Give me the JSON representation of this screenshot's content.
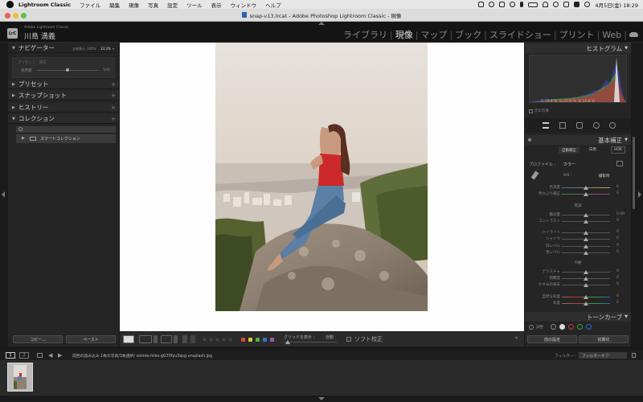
{
  "menubar": {
    "app": "Lightroom Classic",
    "items": [
      "ファイル",
      "編集",
      "現像",
      "写真",
      "設定",
      "ツール",
      "表示",
      "ウィンドウ",
      "ヘルプ"
    ],
    "datetime": "4月5日(金)  18:29"
  },
  "window": {
    "title": "snap-v13.lrcat - Adobe Photoshop Lightroom Classic - 現像"
  },
  "identity": {
    "small": "Adobe Lightroom Classic",
    "name": "川島 満義",
    "badge": "LrC"
  },
  "modules": [
    "ライブラリ",
    "現像",
    "マップ",
    "ブック",
    "スライドショー",
    "プリント",
    "Web"
  ],
  "active_module": "現像",
  "left_panel": {
    "navigator": {
      "label": "ナビゲーター",
      "zoom_options": [
        "全体表示",
        "100%",
        "33.3%"
      ]
    },
    "preset_amount": {
      "label": "プリセット : 補正",
      "sub": "適用量",
      "value": "100"
    },
    "sections": [
      "プリセット",
      "スナップショット",
      "ヒストリー",
      "コレクション"
    ],
    "collection_item": "スマートコレクション",
    "copy_label": "コピー...",
    "paste_label": "ペースト"
  },
  "right_panel": {
    "histogram_label": "ヒストグラム",
    "histogram_readout": {
      "r_label": "R",
      "r_value": "79.4",
      "g_label": "G",
      "g_value": "22.0",
      "b_label": "B",
      "b_value": "14.8",
      "unit": "%"
    },
    "original_photo": "元の写真",
    "basic_label": "基本補正",
    "auto_buttons": [
      "自動補正",
      "白黒",
      "HDR"
    ],
    "profile_label": "プロファイル :",
    "profile_value": "カラー",
    "wb_label": "WB :",
    "wb_value": "撮影時",
    "tone_group": "階調",
    "presence_group": "外観",
    "sliders": [
      {
        "label": "色温度",
        "value": "0"
      },
      {
        "label": "色かぶり補正",
        "value": "0"
      },
      {
        "label": "露光量",
        "value": "0.00"
      },
      {
        "label": "コントラスト",
        "value": "0"
      },
      {
        "label": "ハイライト",
        "value": "0"
      },
      {
        "label": "シャドウ",
        "value": "0"
      },
      {
        "label": "白レベル",
        "value": "0"
      },
      {
        "label": "黒レベル",
        "value": "0"
      },
      {
        "label": "テクスチャ",
        "value": "0"
      },
      {
        "label": "明瞭度",
        "value": "0"
      },
      {
        "label": "かすみの除去",
        "value": "0"
      },
      {
        "label": "自然な彩度",
        "value": "0"
      },
      {
        "label": "彩度",
        "value": "0"
      }
    ],
    "tone_curve_label": "トーンカーブ",
    "curve_adjust": "調整",
    "previous_label": "前の設定",
    "reset_label": "初期化"
  },
  "toolbar": {
    "grid_label": "グリッドを表示 :",
    "grid_value": "自動",
    "soft_proof": "ソフト校正",
    "label_colors": [
      "#d94a3c",
      "#d8c53a",
      "#4fae4f",
      "#3d72c8",
      "#8e5bb6"
    ]
  },
  "filmstrip": {
    "page1": "1",
    "page2": "2",
    "path": "前回の読み込み  1枚の写真/1枚選択/ sonnie-hiles-gG70fyu3qsg-unsplash.jpg",
    "filter_label": "フィルター :",
    "filter_value": "フィルターオフ"
  },
  "colors": {
    "panel": "#252525",
    "background": "#1a1a1a",
    "accent_dress": "#cc2a2a"
  }
}
